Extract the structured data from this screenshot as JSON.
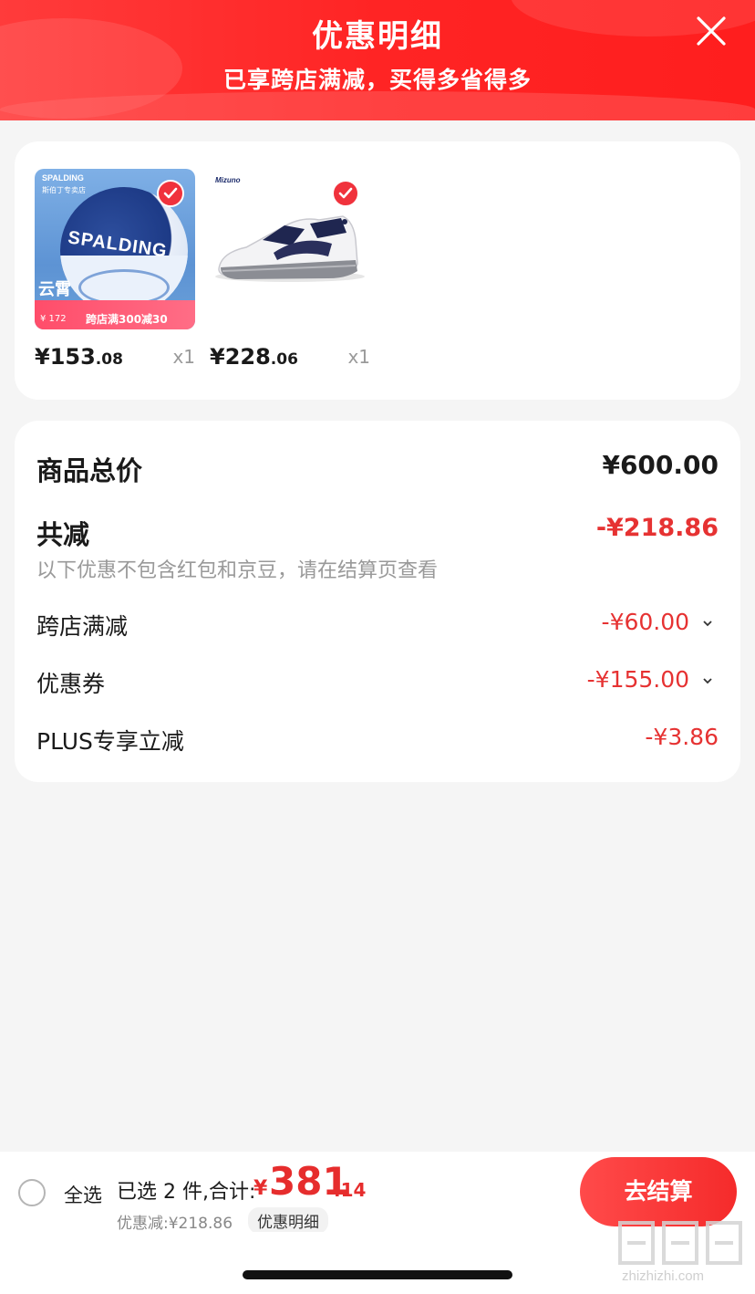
{
  "header": {
    "title": "优惠明细",
    "subtitle": "已享跨店满减，买得多省得多"
  },
  "products": [
    {
      "price_int": "¥153",
      "price_dec": ".08",
      "qty": "x1",
      "thumb_brand": "SPALDING",
      "thumb_store": "斯伯丁专卖店",
      "thumb_ball_text": "SPALDING",
      "thumb_cloud": "云霄",
      "thumb_promo_price": "¥ 172",
      "thumb_promo": "跨店满300减30",
      "checked": true
    },
    {
      "price_int": "¥228",
      "price_dec": ".06",
      "qty": "x1",
      "thumb_brand": "Mizuno",
      "checked": true
    }
  ],
  "summary": {
    "total_label": "商品总价",
    "total_value": "¥600.00",
    "discount_label": "共减",
    "discount_value": "-¥218.86",
    "note": "以下优惠不包含红包和京豆，请在结算页查看",
    "items": [
      {
        "label": "跨店满减",
        "value": "-¥60.00",
        "expandable": true
      },
      {
        "label": "优惠券",
        "value": "-¥155.00",
        "expandable": true
      },
      {
        "label": "PLUS专享立减",
        "value": "-¥3.86",
        "expandable": false
      }
    ]
  },
  "bottom": {
    "select_all": "全选",
    "selected_text": "已选 2 件,合计:",
    "total_symbol": "¥",
    "total_int": "381",
    "total_dec": ".14",
    "saved_text": "优惠减:¥218.86",
    "detail_link": "优惠明细",
    "checkout": "去结算"
  },
  "watermark": "zhizhizhi.com",
  "colors": {
    "accent": "#f52b2b",
    "price_red": "#e63232",
    "background": "#f5f5f5"
  }
}
